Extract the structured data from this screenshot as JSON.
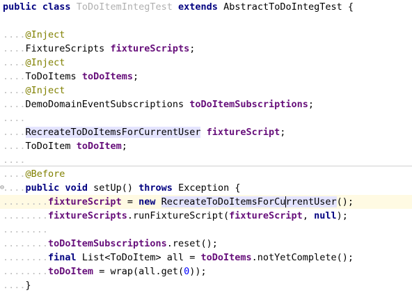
{
  "code": {
    "line0": {
      "kw_public": "public",
      "kw_class": "class",
      "class_name": "ToDoItemIntegTest",
      "kw_extends": "extends",
      "superclass": "AbstractToDoIntegTest",
      "brace": "{"
    },
    "line2": {
      "ann": "@Inject"
    },
    "line3": {
      "type": "FixtureScripts",
      "field": "fixtureScripts",
      "semi": ";"
    },
    "line4": {
      "ann": "@Inject"
    },
    "line5": {
      "type": "ToDoItems",
      "field": "toDoItems",
      "semi": ";"
    },
    "line6": {
      "ann": "@Inject"
    },
    "line7": {
      "type": "DemoDomainEventSubscriptions",
      "field": "toDoItemSubscriptions",
      "semi": ";"
    },
    "line9": {
      "type": "RecreateToDoItemsForCurrentUser",
      "field": "fixtureScript",
      "semi": ";"
    },
    "line10": {
      "type": "ToDoItem",
      "field": "toDoItem",
      "semi": ";"
    },
    "line12": {
      "ann": "@Before"
    },
    "line13": {
      "kw_public": "public",
      "kw_void": "void",
      "method": "setUp()",
      "kw_throws": "throws",
      "exception": "Exception",
      "brace": "{"
    },
    "line14": {
      "field": "fixtureScript",
      "assign": " = ",
      "kw_new": "new",
      "ctor_a": "RecreateToDoItemsForCu",
      "ctor_b": "rrentUser",
      "tail": "();"
    },
    "line15": {
      "field": "fixtureScripts",
      "call": ".runFixtureScript(",
      "arg": "fixtureScript",
      "comma": ", ",
      "kw_null": "null",
      "tail": ");"
    },
    "line17": {
      "field": "toDoItemSubscriptions",
      "call": ".reset();"
    },
    "line18": {
      "kw_final": "final",
      "type": "List<ToDoItem> all = ",
      "field": "toDoItems",
      "call": ".notYetComplete();"
    },
    "line19": {
      "field": "toDoItem",
      "assign": " = wrap(all.get(",
      "num": "0",
      "tail": "));"
    },
    "line20": {
      "brace": "}"
    }
  }
}
